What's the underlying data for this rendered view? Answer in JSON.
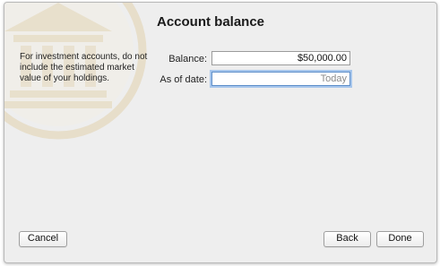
{
  "dialog": {
    "title": "Account balance",
    "note": "For investment accounts, do not include the estimated market value of your holdings."
  },
  "form": {
    "balance_label": "Balance:",
    "balance_value": "$50,000.00",
    "as_of_label": "As of date:",
    "as_of_placeholder": "Today"
  },
  "buttons": {
    "cancel": "Cancel",
    "back": "Back",
    "done": "Done"
  },
  "icons": {
    "watermark": "bank-building-icon"
  },
  "colors": {
    "window_bg": "#eeeeee",
    "focus_ring": "#a7c6ec",
    "watermark": "#e6dcc4"
  }
}
